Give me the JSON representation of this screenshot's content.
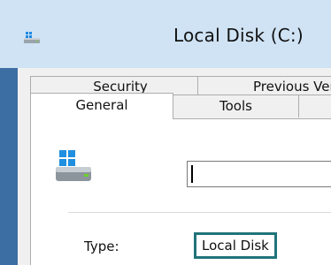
{
  "window": {
    "title": "Local Disk (C:)",
    "accent_color": "#20737a",
    "frame_color": "#3c6ea4",
    "title_icon": "drive-icon"
  },
  "tabs": {
    "back_row": [
      {
        "label": "Security"
      },
      {
        "label": "Previous Versions"
      }
    ],
    "front_row": [
      {
        "label": "General",
        "selected": true
      },
      {
        "label": "Tools"
      }
    ]
  },
  "general": {
    "drive_icon": "hard-drive-icon",
    "name_value": "",
    "type_label": "Type:",
    "type_value": "Local Disk"
  }
}
